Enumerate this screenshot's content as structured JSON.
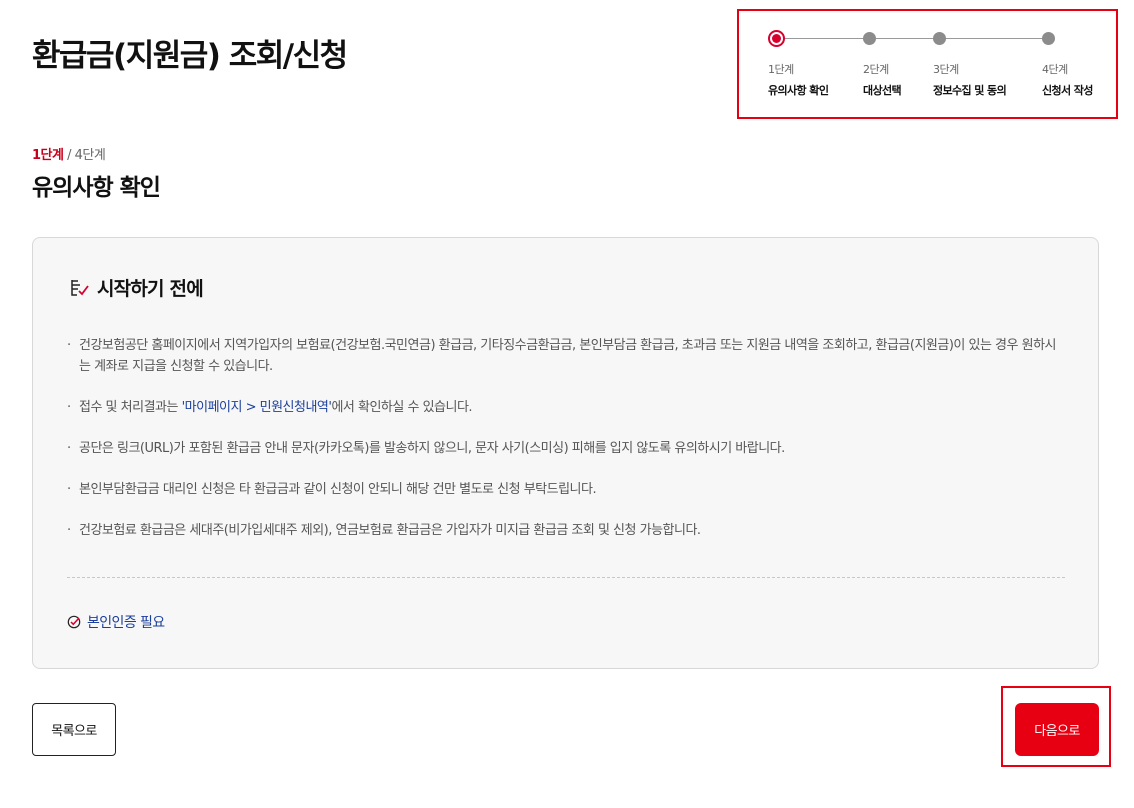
{
  "page_title": "환급금(지원금) 조회/신청",
  "stepper": {
    "steps": [
      {
        "num": "1단계",
        "name": "유의사항 확인",
        "active": true
      },
      {
        "num": "2단계",
        "name": "대상선택",
        "active": false
      },
      {
        "num": "3단계",
        "name": "정보수집 및 동의",
        "active": false
      },
      {
        "num": "4단계",
        "name": "신청서 작성",
        "active": false
      }
    ]
  },
  "stage": {
    "current": "1단계",
    "separator": " / ",
    "total": "4단계",
    "heading": "유의사항 확인"
  },
  "notice": {
    "title": "시작하기 전에",
    "items": [
      {
        "text": "건강보험공단 홈페이지에서 지역가입자의 보험료(건강보험.국민연금) 환급금, 기타징수금환급금, 본인부담금 환급금, 초과금 또는 지원금 내역을 조회하고, 환급금(지원금)이 있는 경우 원하시는 계좌로 지급을 신청할 수 있습니다."
      },
      {
        "prefix": "접수 및 처리결과는 ",
        "link": "'마이페이지 > 민원신청내역'",
        "suffix": "에서 확인하실 수 있습니다."
      },
      {
        "text": "공단은 링크(URL)가 포함된 환급금 안내 문자(카카오톡)를 발송하지 않으니, 문자 사기(스미싱) 피해를 입지 않도록 유의하시기 바랍니다."
      },
      {
        "text": "본인부담환급금 대리인 신청은 타 환급금과 같이 신청이 안되니 해당 건만 별도로 신청 부탁드립니다."
      },
      {
        "text": "건강보험료 환급금은 세대주(비가입세대주 제외), 연금보험료 환급금은 가입자가 미지급 환급금 조회 및 신청 가능합니다."
      }
    ],
    "auth_label": "본인인증 필요"
  },
  "buttons": {
    "list": "목록으로",
    "next": "다음으로"
  },
  "colors": {
    "accent": "#e60012",
    "active_step": "#d7002f",
    "link": "#1c3f9c"
  }
}
